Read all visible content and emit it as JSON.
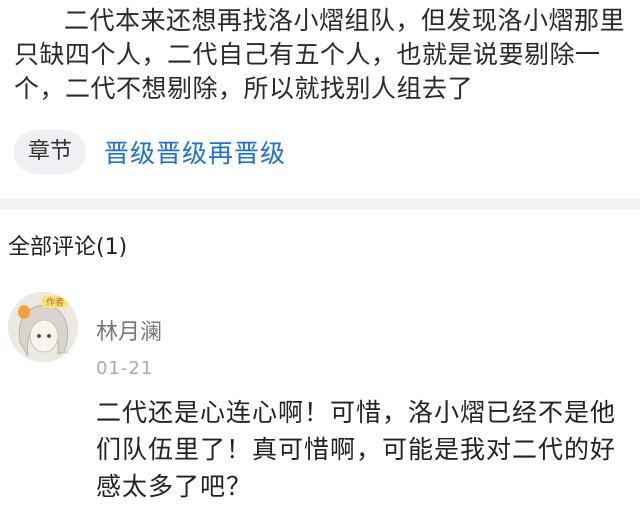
{
  "article": {
    "paragraph": "二代本来还想再找洛小熠组队，但发现洛小熠那里只缺四个人，二代自己有五个人，也就是说要剔除一个，二代不想剔除，所以就找别人组去了"
  },
  "chapter": {
    "tag_label": "章节",
    "link_text": "晋级晋级再晋级",
    "link_color": "#1e6fd9"
  },
  "comments": {
    "title": "全部评论(1)",
    "items": [
      {
        "username": "林月澜",
        "date": "01-21",
        "avatar_badge": "作者",
        "text": "二代还是心连心啊！可惜，洛小熠已经不是他们队伍里了！真可惜啊，可能是我对二代的好感太多了吧？"
      }
    ]
  }
}
